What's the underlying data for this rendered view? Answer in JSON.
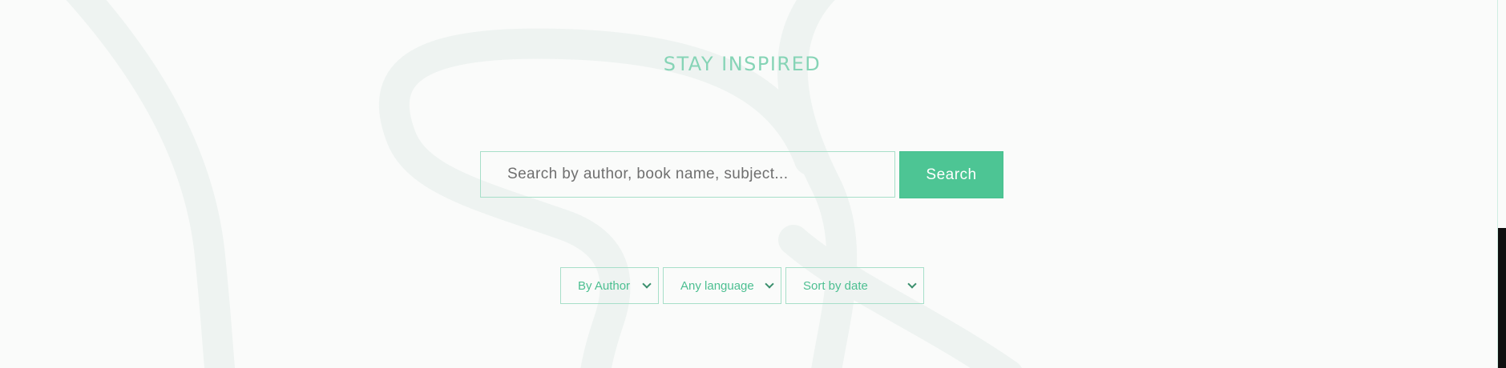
{
  "hero": {
    "heading": "STAY INSPIRED"
  },
  "search": {
    "placeholder": "Search by author, book name, subject...",
    "button_label": "Search"
  },
  "filters": {
    "by": "By Author",
    "language": "Any language",
    "sort": "Sort by date"
  },
  "colors": {
    "accent": "#4dc594",
    "heading": "#86d4b6",
    "border": "#a7dfc9",
    "background": "#fafbfa"
  }
}
